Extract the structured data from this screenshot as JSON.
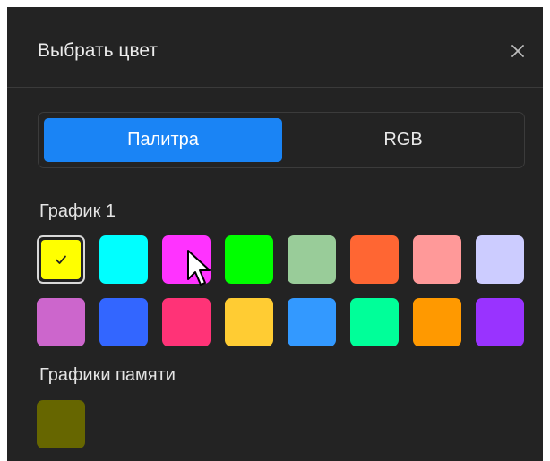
{
  "dialog": {
    "title": "Выбрать цвет",
    "close_icon": "close-icon"
  },
  "tabs": [
    {
      "label": "Палитра",
      "active": true
    },
    {
      "label": "RGB",
      "active": false
    }
  ],
  "palette": {
    "section_label": "График 1",
    "rows": [
      [
        {
          "color": "#ffff00",
          "selected": true
        },
        {
          "color": "#00ffff",
          "selected": false
        },
        {
          "color": "#ff33ff",
          "selected": false
        },
        {
          "color": "#00ff00",
          "selected": false
        },
        {
          "color": "#99cc99",
          "selected": false
        },
        {
          "color": "#ff6633",
          "selected": false
        },
        {
          "color": "#ff9999",
          "selected": false
        },
        {
          "color": "#ccccff",
          "selected": false
        }
      ],
      [
        {
          "color": "#cc66cc",
          "selected": false
        },
        {
          "color": "#3366ff",
          "selected": false
        },
        {
          "color": "#ff3377",
          "selected": false
        },
        {
          "color": "#ffcc33",
          "selected": false
        },
        {
          "color": "#3399ff",
          "selected": false
        },
        {
          "color": "#00ff99",
          "selected": false
        },
        {
          "color": "#ff9900",
          "selected": false
        },
        {
          "color": "#9933ff",
          "selected": false
        }
      ]
    ]
  },
  "memory": {
    "section_label": "Графики памяти",
    "swatches": [
      {
        "color": "#666600",
        "selected": false
      }
    ]
  },
  "icons": {
    "check": "check-icon",
    "cursor": "mouse-cursor-icon"
  },
  "colors": {
    "accent": "#1a84f5",
    "dialog_bg": "#232323"
  }
}
